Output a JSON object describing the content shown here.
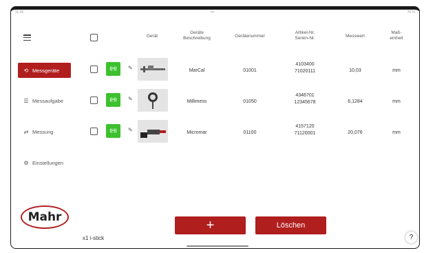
{
  "status_bar": {
    "time": "11:26",
    "center": "•••",
    "battery": "76 %"
  },
  "sidebar": {
    "items": [
      {
        "label": "Messgeräte",
        "icon": "ruler-icon",
        "active": true
      },
      {
        "label": "Messaufgabe",
        "icon": "list-icon",
        "active": false
      },
      {
        "label": "Messung",
        "icon": "arrows-icon",
        "active": false
      },
      {
        "label": "Einstellungen",
        "icon": "gear-icon",
        "active": false
      }
    ],
    "logo": "Mahr"
  },
  "table": {
    "headers": {
      "device": "Gerät",
      "description": "Geräte\nBeschreibung",
      "number": "Gerätenummer",
      "article": "Artikel-Nr.\nSerien-Nr.",
      "value": "Messwert",
      "unit": "Maß-\neinheit"
    },
    "rows": [
      {
        "description": "MarCal",
        "number": "01001",
        "article": "4103400\n71020111",
        "value": "10,03",
        "unit": "mm"
      },
      {
        "description": "Millimess",
        "number": "01050",
        "article": "4346701\n12345678",
        "value": "6,1284",
        "unit": "mm"
      },
      {
        "description": "Micromar",
        "number": "01100",
        "article": "4157120\n71120001",
        "value": "20,076",
        "unit": "mm"
      }
    ]
  },
  "footer": {
    "stick_label": "x1 i-stick",
    "add_label": "+",
    "delete_label": "Löschen",
    "help_label": "?"
  },
  "colors": {
    "accent": "#b01e1e",
    "connected": "#3cc12d"
  }
}
